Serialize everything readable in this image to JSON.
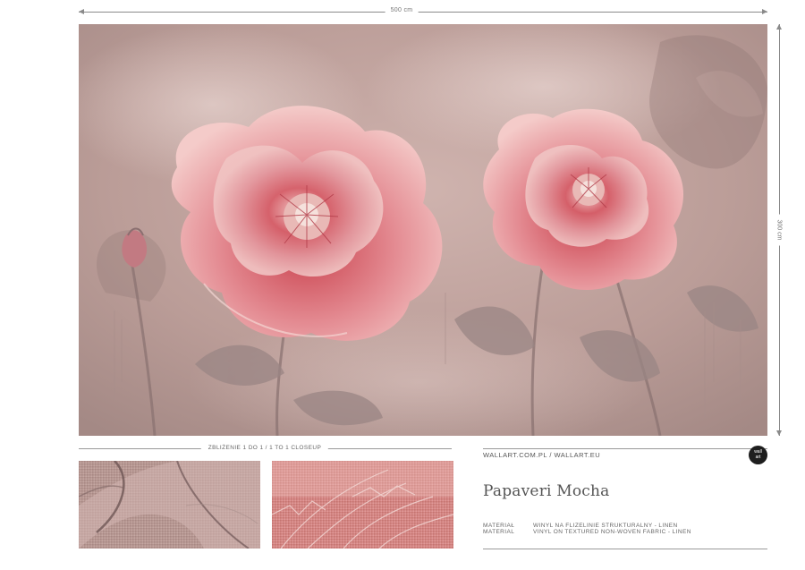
{
  "dimensions": {
    "width_label": "500 cm",
    "height_label": "300 cm"
  },
  "closeup": {
    "label": "ZBLIŻENIE 1 DO 1 / 1 TO 1 CLOSEUP"
  },
  "info": {
    "site": "WALLART.COM.PL / WALLART.EU",
    "logo_text_1": "wall",
    "logo_text_2": "art",
    "title": "Papaveri Mocha",
    "materials": [
      {
        "label": "MATERIAŁ",
        "value": "WINYL NA FLIZELINIE STRUKTURALNY - LINEN"
      },
      {
        "label": "MATERIAL",
        "value": "VINYL ON TEXTURED NON-WOVEN FABRIC - LINEN"
      }
    ]
  },
  "colors": {
    "background_tone": "#c6a8a3",
    "petal_pink": "#e79ca0",
    "petal_red": "#c2424f",
    "leaf_gray": "#9a8584"
  }
}
